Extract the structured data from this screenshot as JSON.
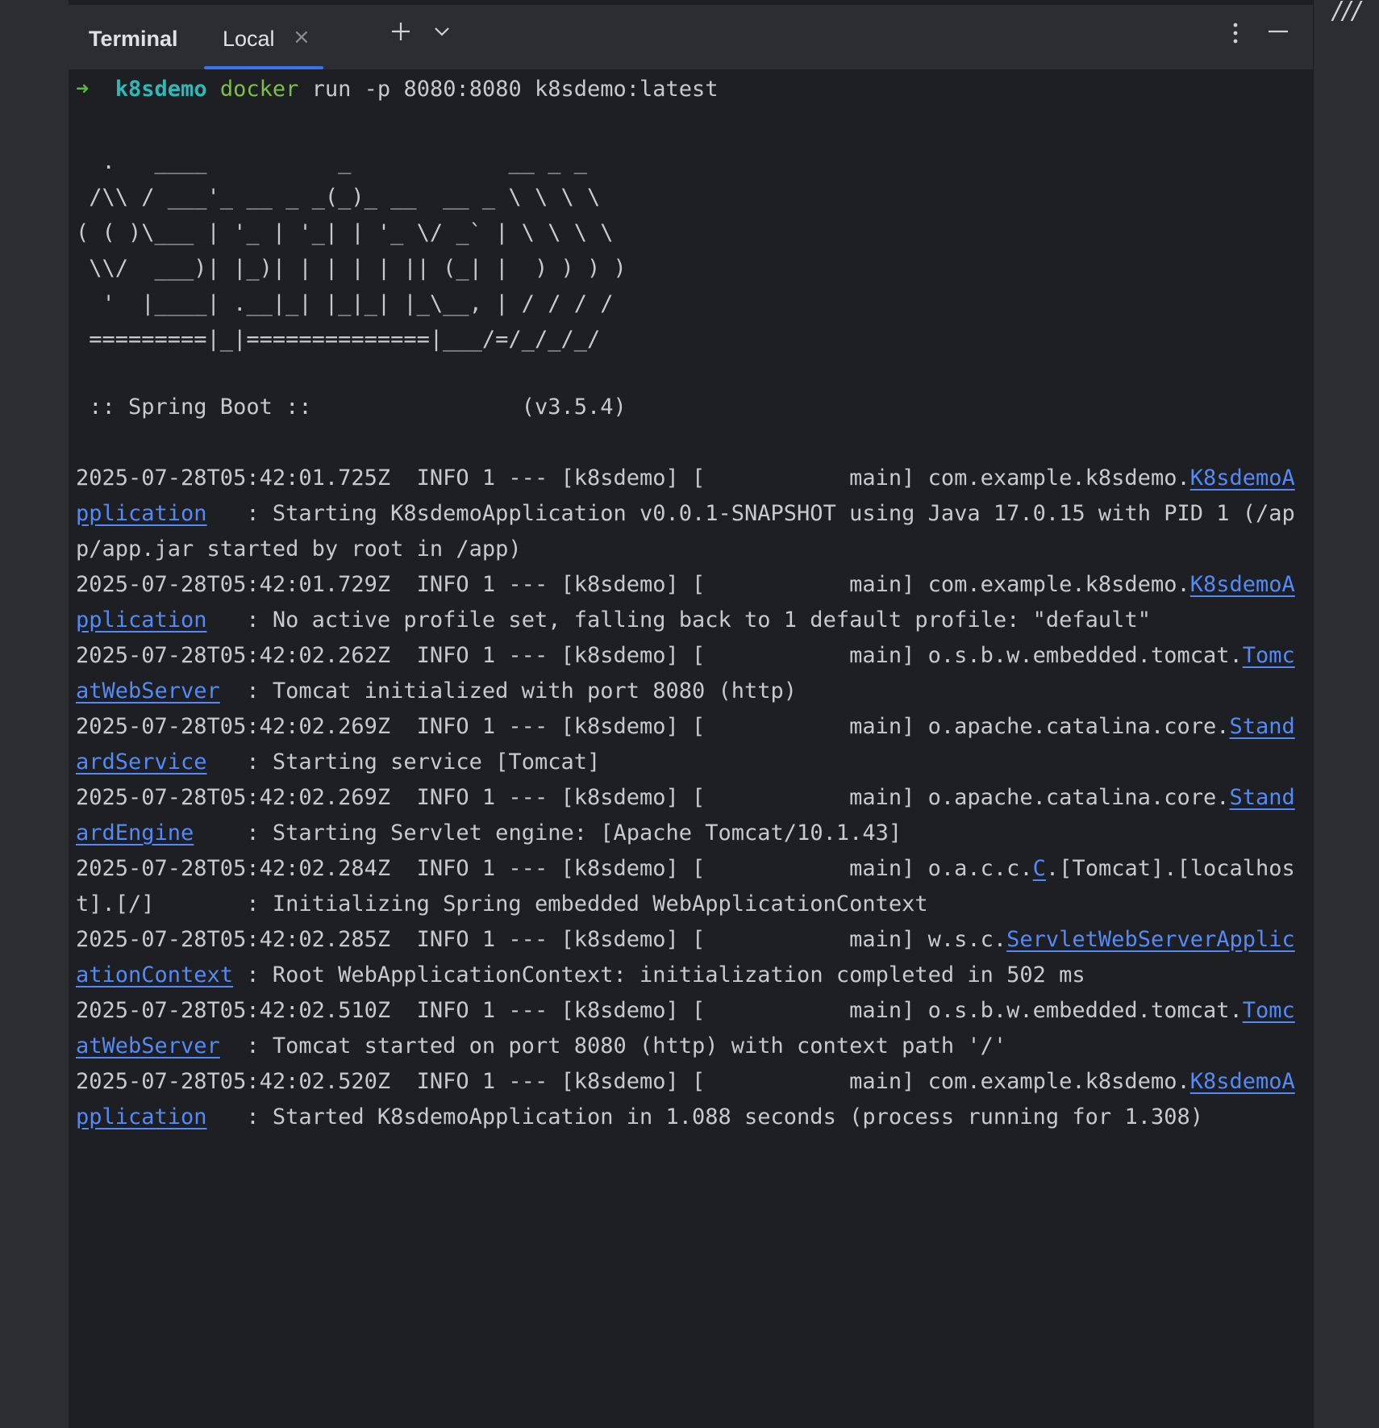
{
  "ide": {
    "right_strip_icon": "drag-handle-icon"
  },
  "toolwindow": {
    "title": "Terminal",
    "tab_label": "Local",
    "tab_close_icon": "close-icon",
    "new_tab_icon": "plus-icon",
    "dropdown_icon": "chevron-down-icon",
    "more_icon": "more-vertical-icon",
    "minimize_icon": "minimize-icon"
  },
  "prompt": {
    "arrow": "➜",
    "directory": "k8sdemo",
    "command": "docker",
    "args": "run -p 8080:8080 k8sdemo:latest"
  },
  "banner_art": "  .   ____          _            __ _ _\n /\\\\ / ___'_ __ _ _(_)_ __  __ _ \\ \\ \\ \\\n( ( )\\___ | '_ | '_| | '_ \\/ _` | \\ \\ \\ \\\n \\\\/  ___)| |_)| | | | | || (_| |  ) ) ) )\n  '  |____| .__|_| |_|_| |_\\__, | / / / /\n =========|_|==============|___/=/_/_/_/",
  "spring_boot_line": " :: Spring Boot ::                (v3.5.4)",
  "log_entries": [
    {
      "prefix": "2025-07-28T05:42:01.725Z  INFO 1 --- [k8sdemo] [           main] com.example.k8sdemo.",
      "link": "K8sdemoApplication",
      "suffix": "   : Starting K8sdemoApplication v0.0.1-SNAPSHOT using Java 17.0.15 with PID 1 (/app/app.jar started by root in /app)"
    },
    {
      "prefix": "2025-07-28T05:42:01.729Z  INFO 1 --- [k8sdemo] [           main] com.example.k8sdemo.",
      "link": "K8sdemoApplication",
      "suffix": "   : No active profile set, falling back to 1 default profile: \"default\""
    },
    {
      "prefix": "2025-07-28T05:42:02.262Z  INFO 1 --- [k8sdemo] [           main] o.s.b.w.embedded.tomcat.",
      "link": "TomcatWebServer",
      "suffix": "  : Tomcat initialized with port 8080 (http)"
    },
    {
      "prefix": "2025-07-28T05:42:02.269Z  INFO 1 --- [k8sdemo] [           main] o.apache.catalina.core.",
      "link": "StandardService",
      "suffix": "   : Starting service [Tomcat]"
    },
    {
      "prefix": "2025-07-28T05:42:02.269Z  INFO 1 --- [k8sdemo] [           main] o.apache.catalina.core.",
      "link": "StandardEngine",
      "suffix": "    : Starting Servlet engine: [Apache Tomcat/10.1.43]"
    },
    {
      "prefix": "2025-07-28T05:42:02.284Z  INFO 1 --- [k8sdemo] [           main] o.a.c.c.",
      "link": "C",
      "suffix": ".[Tomcat].[localhost].[/]       : Initializing Spring embedded WebApplicationContext"
    },
    {
      "prefix": "2025-07-28T05:42:02.285Z  INFO 1 --- [k8sdemo] [           main] w.s.c.",
      "link": "ServletWebServerApplicationContext",
      "suffix": " : Root WebApplicationContext: initialization completed in 502 ms"
    },
    {
      "prefix": "2025-07-28T05:42:02.510Z  INFO 1 --- [k8sdemo] [           main] o.s.b.w.embedded.tomcat.",
      "link": "TomcatWebServer",
      "suffix": "  : Tomcat started on port 8080 (http) with context path '/'"
    },
    {
      "prefix": "2025-07-28T05:42:02.520Z  INFO 1 --- [k8sdemo] [           main] com.example.k8sdemo.",
      "link": "K8sdemoApplication",
      "suffix": "   : Started K8sdemoApplication in 1.088 seconds (process running for 1.308)"
    }
  ]
}
